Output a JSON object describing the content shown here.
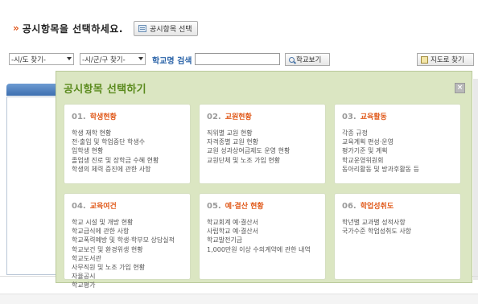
{
  "header": {
    "prompt_arrow": "»",
    "prompt": "공시항목을 선택하세요.",
    "select_button": "공시항목 선택"
  },
  "filters": {
    "sido": "-시/도 찾기-",
    "sigungu": "-시/군/구 찾기-",
    "school_label": "학교명 검색",
    "school_input": "",
    "view_button": "학교보기",
    "map_button": "지도로 찾기"
  },
  "modal": {
    "title": "공시항목 선택하기",
    "close": "×",
    "cards": [
      {
        "num": "01.",
        "title": "학생현황",
        "items": [
          "학생 재학 현황",
          "전·출입 및 학업중단 학생수",
          "입학생 현황",
          "졸업생 진로 및 장학금 수혜 현황",
          "학생의 체력 증진에 관한 사항"
        ]
      },
      {
        "num": "02.",
        "title": "교원현황",
        "items": [
          "직위별 교원 현황",
          "자격종별 교원 현황",
          "교원 성과상여금제도 운영 현황",
          "교원단체 및 노조 가입 현황"
        ]
      },
      {
        "num": "03.",
        "title": "교육활동",
        "items": [
          "각종 규정",
          "교육계획 편성·운영",
          "평가기준 및 계획",
          "학교운영위원회",
          "동아리활동 및 방과후활동 등"
        ]
      },
      {
        "num": "04.",
        "title": "교육여건",
        "items": [
          "학교 시설 및 개방 현황",
          "학교급식에 관한 사항",
          "학교폭력예방 및 학생·학부모 상담실적",
          "학교보건 및 환경위생 현황",
          "학교도서관",
          "사무직원 및 노조 가입 현황",
          "자율공시",
          "학교평가"
        ]
      },
      {
        "num": "05.",
        "title": "예·결산 현황",
        "items": [
          "학교회계 예·결산서",
          "사립학교 예·결산서",
          "학교발전기금",
          "1,000만원 이상 수의계약에 관한 내역"
        ]
      },
      {
        "num": "06.",
        "title": "학업성취도",
        "items": [
          "학년별 교과별 성적사항",
          "국가수준 학업성취도 사항"
        ]
      }
    ]
  }
}
